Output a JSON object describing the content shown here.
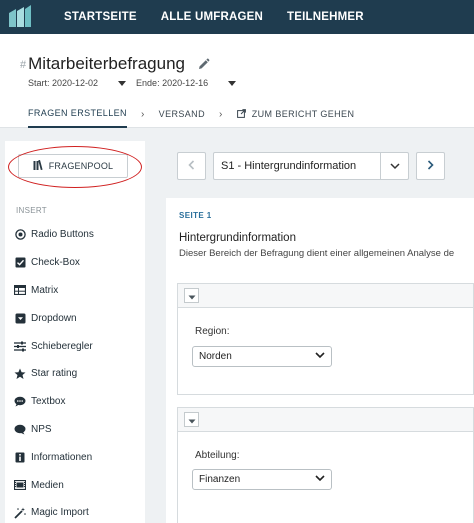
{
  "nav": {
    "logo_icon": "app-logo",
    "items": [
      {
        "label": "STARTSEITE"
      },
      {
        "label": "ALLE UMFRAGEN"
      },
      {
        "label": "TEILNEHMER"
      }
    ]
  },
  "survey": {
    "hash": "#",
    "title": "Mitarbeiterbefragung",
    "start_label": "Start: 2020-12-02",
    "end_label": "Ende: 2020-12-16"
  },
  "tabs": {
    "items": [
      {
        "label": "FRAGEN ERSTELLEN",
        "active": true
      },
      {
        "label": "VERSAND"
      },
      {
        "label": "ZUM BERICHT GEHEN"
      }
    ],
    "separator": "›"
  },
  "sidebar": {
    "pool_button": "FRAGENPOOL",
    "insert_label": "INSERT",
    "items": [
      {
        "label": "Radio Buttons",
        "icon": "radio-icon"
      },
      {
        "label": "Check-Box",
        "icon": "checkbox-icon"
      },
      {
        "label": "Matrix",
        "icon": "matrix-icon"
      },
      {
        "label": "Dropdown",
        "icon": "dropdown-icon"
      },
      {
        "label": "Schieberegler",
        "icon": "slider-icon"
      },
      {
        "label": "Star rating",
        "icon": "star-icon"
      },
      {
        "label": "Textbox",
        "icon": "textbox-icon"
      },
      {
        "label": "NPS",
        "icon": "nps-icon"
      },
      {
        "label": "Informationen",
        "icon": "info-icon"
      },
      {
        "label": "Medien",
        "icon": "media-icon"
      },
      {
        "label": "Magic Import",
        "icon": "magic-wand-icon"
      }
    ]
  },
  "page_selector": {
    "selected": "S1 - Hintergrundinformation"
  },
  "page": {
    "seite_label": "SEITE 1",
    "title": "Hintergrundinformation",
    "description": "Dieser Bereich der Befragung dient einer allgemeinen Analyse de"
  },
  "questions": [
    {
      "label": "Region:",
      "value": "Norden"
    },
    {
      "label": "Abteilung:",
      "value": "Finanzen"
    }
  ],
  "colors": {
    "nav_bg": "#1f3c4f",
    "content_bg": "#eef1f3",
    "highlight_circle": "#d02020",
    "seite_label": "#2a6f9b"
  }
}
